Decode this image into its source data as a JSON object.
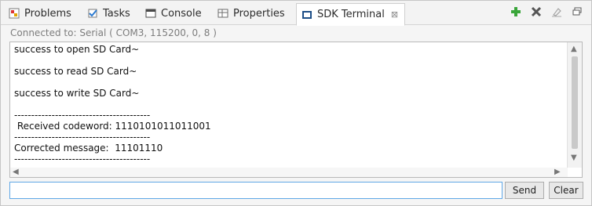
{
  "tabs": [
    {
      "label": "Problems",
      "icon": "problems-icon"
    },
    {
      "label": "Tasks",
      "icon": "tasks-icon"
    },
    {
      "label": "Console",
      "icon": "console-icon"
    },
    {
      "label": "Properties",
      "icon": "properties-icon"
    },
    {
      "label": "SDK Terminal",
      "icon": "terminal-icon",
      "active": true
    }
  ],
  "toolbar": {
    "add_icon": "plus-icon",
    "remove_icon": "x-icon",
    "clear_icon": "eraser-icon",
    "restore_icon": "restore-window-icon"
  },
  "status": {
    "text": "Connected to: Serial (  COM3, 115200, 0, 8 )"
  },
  "console": {
    "lines": [
      "success to open SD Card~",
      "success to read SD Card~",
      "success to write SD Card~",
      "----------------------------------------",
      " Received codeword: 1110101011011001",
      "----------------------------------------",
      "Corrected message:  11101110",
      "----------------------------------------"
    ]
  },
  "input": {
    "value": "",
    "placeholder": ""
  },
  "buttons": {
    "send": "Send",
    "clear": "Clear"
  },
  "colors": {
    "accent": "#5fa7e6",
    "add": "#3aa53a",
    "remove": "#555555"
  }
}
